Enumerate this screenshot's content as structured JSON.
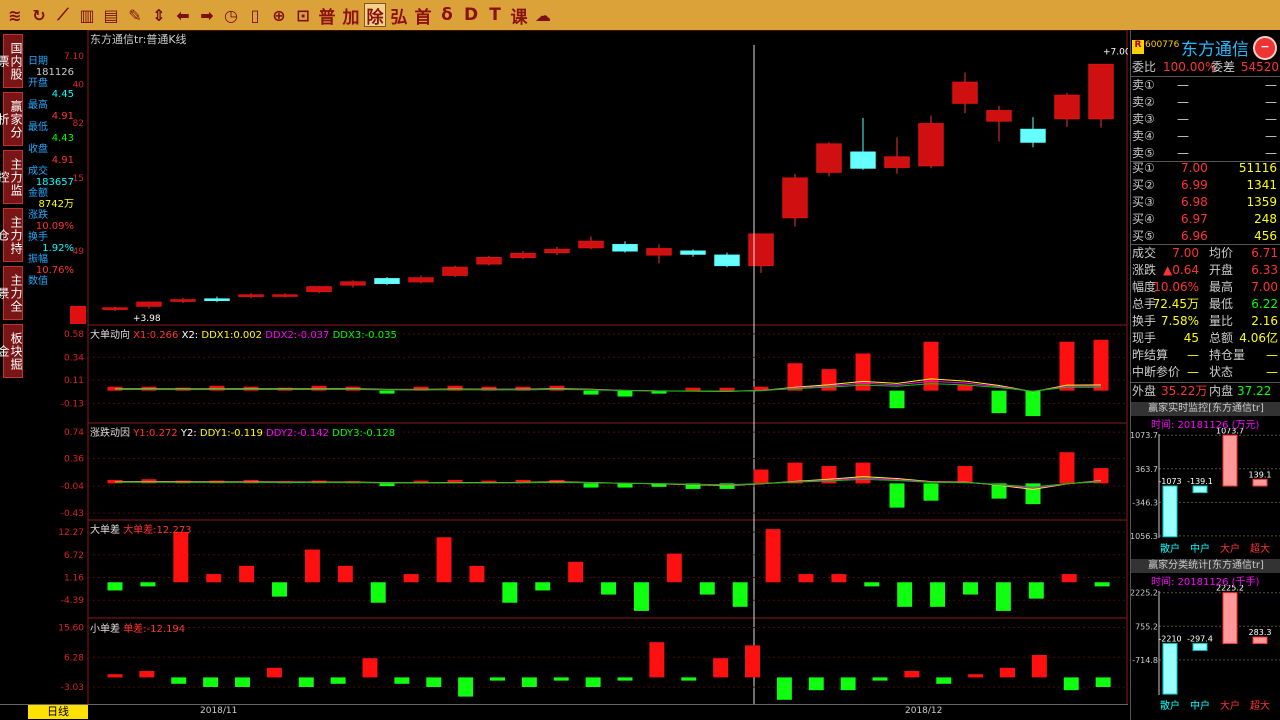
{
  "toolbar": {
    "text_buttons": [
      "普",
      "加",
      "除",
      "弘",
      "首",
      "δ",
      "D",
      "T",
      "课"
    ]
  },
  "sidebar": {
    "items": [
      "国内股票",
      "赢家分析",
      "主力监控",
      "主力持仓",
      "主力全景",
      "板块掘金"
    ]
  },
  "info": {
    "labels": [
      "日期",
      "开盘",
      "最高",
      "最低",
      "收盘",
      "成交",
      "金额",
      "涨跌",
      "换手",
      "振幅",
      "数值"
    ],
    "values": [
      "181126",
      "4.45",
      "4.91",
      "4.43",
      "4.91",
      "183657",
      "8742万",
      "10.09%",
      "1.92%",
      "10.76%",
      ""
    ]
  },
  "price_panel": {
    "title": "东方通信tr:普通K线",
    "high_label": "+7.00",
    "low_label": "+3.98",
    "axis": [
      "7.10",
      "40",
      "82",
      "15",
      "49"
    ]
  },
  "ddx_panel": {
    "legend_title": "大单动向",
    "legend": [
      "X1:0.266",
      "X2:",
      "DDX1:0.002",
      "DDX2:-0.037",
      "DDX3:-0.035"
    ],
    "axis": [
      "0.58",
      "0.34",
      "0.11",
      "-0.13"
    ]
  },
  "ddy_panel": {
    "legend_title": "涨跌动因",
    "legend": [
      "Y1:0.272",
      "Y2:",
      "DDY1:-0.119",
      "DDY2:-0.142",
      "DDY3:-0.128"
    ],
    "axis": [
      "0.74",
      "0.36",
      "-0.04",
      "-0.43"
    ]
  },
  "big_panel": {
    "legend_title": "大单差",
    "legend": [
      "大单差:12.273"
    ],
    "axis": [
      "12.27",
      "6.72",
      "1.16",
      "-4.39"
    ]
  },
  "small_panel": {
    "legend_title": "小单差",
    "legend": [
      "单差:-12.194"
    ],
    "axis": [
      "15.60",
      "6.28",
      "-3.03"
    ]
  },
  "bottom": {
    "tab": "日线",
    "dates": [
      "2018/11",
      "2018/12"
    ]
  },
  "quote": {
    "code": "600776",
    "badge": "R",
    "name": "东方通信",
    "weibi_label": "委比",
    "weibi": "100.00%",
    "weicha_label": "委差",
    "weicha": "54520",
    "sells": [
      {
        "l": "卖⑤",
        "p": "—",
        "v": "—"
      },
      {
        "l": "卖④",
        "p": "—",
        "v": "—"
      },
      {
        "l": "卖③",
        "p": "—",
        "v": "—"
      },
      {
        "l": "卖②",
        "p": "—",
        "v": "—"
      },
      {
        "l": "卖①",
        "p": "—",
        "v": "—"
      }
    ],
    "buys": [
      {
        "l": "买①",
        "p": "7.00",
        "v": "51116"
      },
      {
        "l": "买②",
        "p": "6.99",
        "v": "1341"
      },
      {
        "l": "买③",
        "p": "6.98",
        "v": "1359"
      },
      {
        "l": "买④",
        "p": "6.97",
        "v": "248"
      },
      {
        "l": "买⑤",
        "p": "6.96",
        "v": "456"
      }
    ],
    "stats": [
      [
        "成交",
        "7.00",
        "均价",
        "6.71"
      ],
      [
        "涨跌",
        "▲0.64",
        "开盘",
        "6.33"
      ],
      [
        "幅度",
        "10.06%",
        "最高",
        "7.00"
      ],
      [
        "总手",
        "72.45万",
        "最低",
        "6.22"
      ],
      [
        "换手",
        "7.58%",
        "量比",
        "2.16"
      ],
      [
        "现手",
        "45",
        "总额",
        "4.06亿"
      ],
      [
        "昨结算",
        "—",
        "持仓量",
        "—"
      ],
      [
        "中断参价",
        "—",
        "状态",
        "—"
      ]
    ],
    "outer_label": "外盘",
    "outer": "35.22万",
    "inner_label": "内盘",
    "inner": "37.22万"
  },
  "monitor": {
    "title": "赢家实时监控[东方通信tr]",
    "time": "时间: 20181126 (万元)",
    "axis": [
      "1073.7",
      "363.7",
      "-346.3",
      "-1056.3"
    ],
    "cats": [
      "散户",
      "中户",
      "大户",
      "超大"
    ],
    "values": [
      -1073.7,
      -139.1,
      1073.7,
      139.1
    ],
    "labels": [
      "-1073",
      "-139.1",
      "1073.7",
      "139.1"
    ]
  },
  "stat": {
    "title": "赢家分类统计[东方通信tr]",
    "time": "时间: 20181126 (千手)",
    "axis": [
      "2225.2",
      "755.2",
      "-714.8"
    ],
    "cats": [
      "散户",
      "中户",
      "大户",
      "超大"
    ],
    "values": [
      -2210,
      -297.4,
      2225.2,
      283.3
    ],
    "labels": [
      "-2210",
      "-297.4",
      "2225.2",
      "283.3"
    ]
  },
  "chart_data": {
    "type": "candlestick",
    "candles": [
      [
        3.98,
        4.0,
        3.96,
        4.01
      ],
      [
        4.02,
        4.07,
        3.99,
        4.08
      ],
      [
        4.08,
        4.1,
        4.06,
        4.12
      ],
      [
        4.11,
        4.09,
        4.07,
        4.14
      ],
      [
        4.14,
        4.16,
        4.12,
        4.18
      ],
      [
        4.15,
        4.16,
        4.13,
        4.18
      ],
      [
        4.2,
        4.26,
        4.18,
        4.27
      ],
      [
        4.28,
        4.32,
        4.25,
        4.34
      ],
      [
        4.36,
        4.3,
        4.28,
        4.38
      ],
      [
        4.32,
        4.37,
        4.3,
        4.4
      ],
      [
        4.4,
        4.5,
        4.38,
        4.52
      ],
      [
        4.54,
        4.62,
        4.52,
        4.64
      ],
      [
        4.62,
        4.67,
        4.6,
        4.7
      ],
      [
        4.68,
        4.72,
        4.65,
        4.75
      ],
      [
        4.74,
        4.82,
        4.72,
        4.88
      ],
      [
        4.78,
        4.7,
        4.68,
        4.82
      ],
      [
        4.65,
        4.73,
        4.55,
        4.78
      ],
      [
        4.7,
        4.66,
        4.63,
        4.72
      ],
      [
        4.65,
        4.52,
        4.5,
        4.68
      ],
      [
        4.52,
        4.91,
        4.43,
        4.91
      ],
      [
        5.11,
        5.6,
        5.0,
        5.65
      ],
      [
        5.67,
        6.02,
        5.62,
        6.04
      ],
      [
        5.92,
        5.72,
        5.7,
        6.34
      ],
      [
        5.73,
        5.86,
        5.65,
        6.1
      ],
      [
        5.75,
        6.27,
        5.72,
        6.37
      ],
      [
        6.52,
        6.78,
        6.4,
        6.9
      ],
      [
        6.3,
        6.43,
        6.05,
        6.49
      ],
      [
        6.2,
        6.04,
        5.98,
        6.35
      ],
      [
        6.33,
        6.62,
        6.23,
        6.65
      ],
      [
        6.33,
        7.0,
        6.22,
        7.0
      ]
    ],
    "ddx": [
      0.04,
      0.04,
      0.03,
      0.05,
      0.04,
      0.03,
      0.05,
      0.04,
      -0.03,
      0.04,
      0.05,
      0.04,
      0.04,
      0.05,
      -0.04,
      -0.06,
      -0.03,
      0.03,
      0.03,
      0.04,
      0.28,
      0.22,
      0.38,
      -0.18,
      0.5,
      0.06,
      -0.23,
      -0.26,
      0.5,
      0.52
    ],
    "ddy": [
      0.05,
      0.06,
      0.04,
      0.04,
      0.05,
      0.03,
      0.04,
      0.03,
      -0.04,
      0.04,
      0.05,
      0.04,
      0.05,
      0.05,
      -0.06,
      -0.06,
      -0.05,
      -0.08,
      -0.08,
      0.2,
      0.3,
      0.25,
      0.3,
      -0.35,
      -0.25,
      0.25,
      -0.22,
      -0.3,
      0.45,
      0.22
    ],
    "big": [
      -2,
      -1,
      12.3,
      2,
      4,
      -3.5,
      8,
      4,
      -5,
      2,
      11,
      4,
      -5,
      -2,
      5,
      -3,
      -7,
      7,
      -3,
      -6,
      13,
      2,
      2,
      -1,
      -6,
      -6,
      -3,
      -7,
      -4,
      2,
      -1
    ],
    "small": [
      1,
      2,
      -2,
      -3,
      -3,
      3,
      -3,
      -2,
      6,
      -2,
      -3,
      -6,
      -1,
      -3,
      -1,
      -3,
      -1,
      11,
      -1,
      6,
      10,
      -7,
      -4,
      -4,
      -1,
      2,
      -2,
      1,
      3,
      7,
      -4,
      -3
    ]
  }
}
